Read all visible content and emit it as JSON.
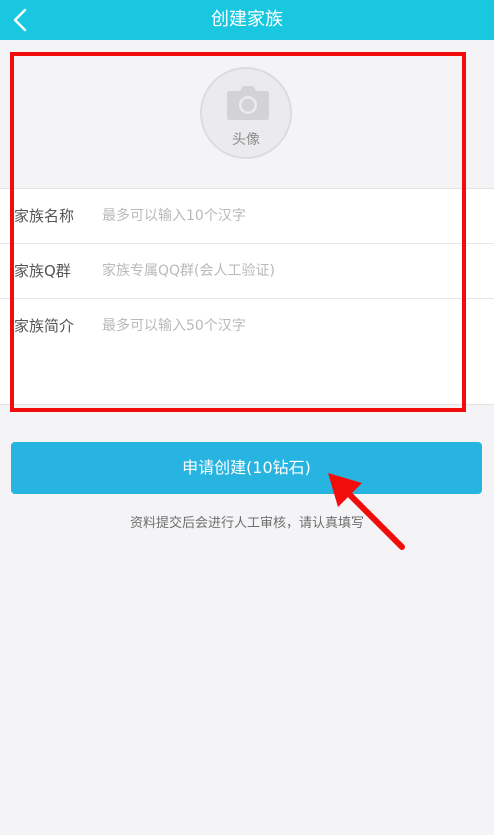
{
  "header": {
    "title": "创建家族",
    "back_icon": "chevron-left-icon"
  },
  "avatar": {
    "label": "头像",
    "icon": "camera-icon"
  },
  "form": {
    "fields": [
      {
        "label": "家族名称",
        "placeholder": "最多可以输入10个汉字",
        "value": ""
      },
      {
        "label": "家族Q群",
        "placeholder": "家族专属QQ群(会人工验证)",
        "value": ""
      },
      {
        "label": "家族简介",
        "placeholder": "最多可以输入50个汉字",
        "value": ""
      }
    ]
  },
  "submit": {
    "label": "申请创建(10钻石)"
  },
  "note": "资料提交后会进行人工审核，请认真填写",
  "colors": {
    "header_bg": "#19c8e0",
    "button_bg": "#28b4e0",
    "highlight": "#f20d0d",
    "page_bg": "#f4f4f6"
  }
}
